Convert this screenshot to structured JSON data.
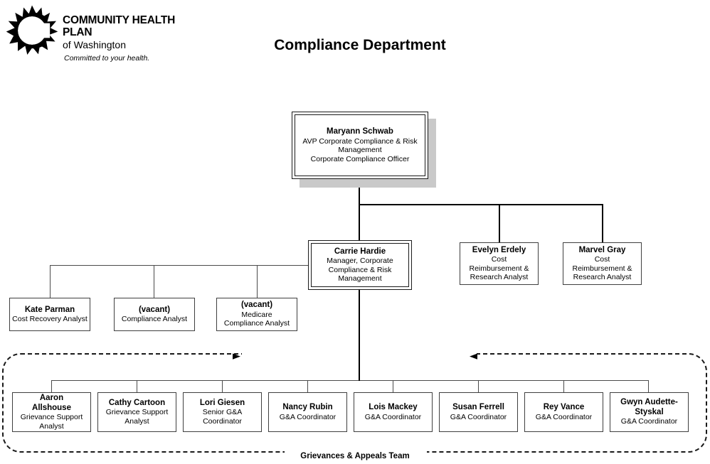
{
  "brand": {
    "logo_icon": "sunburst-c-logo",
    "line1": "COMMUNITY HEALTH PLAN",
    "line2": "of Washington",
    "tagline": "Committed to your health."
  },
  "header": {
    "title": "Compliance Department"
  },
  "org_chart": {
    "type": "org-hierarchy",
    "levels": [
      {
        "level": 1,
        "nodes": [
          {
            "id": "maryann-schwab",
            "name": "Maryann Schwab",
            "title_lines": [
              "AVP Corporate Compliance & Risk",
              "Management",
              "Corporate Compliance Officer"
            ],
            "emphasis": "double-border-shadow"
          }
        ]
      },
      {
        "level": 2,
        "nodes": [
          {
            "id": "carrie-hardie",
            "name": "Carrie Hardie",
            "title_lines": [
              "Manager, Corporate",
              "Compliance & Risk",
              "Management"
            ],
            "emphasis": "double-border",
            "reports_to": "maryann-schwab"
          },
          {
            "id": "evelyn-erdely",
            "name": "Evelyn Erdely",
            "title_lines": [
              "Cost",
              "Reimbursement &",
              "Research Analyst"
            ],
            "emphasis": "single-border",
            "reports_to": "maryann-schwab"
          },
          {
            "id": "marvel-gray",
            "name": "Marvel Gray",
            "title_lines": [
              "Cost",
              "Reimbursement &",
              "Research Analyst"
            ],
            "emphasis": "single-border",
            "reports_to": "maryann-schwab"
          }
        ]
      },
      {
        "level": 3,
        "nodes": [
          {
            "id": "kate-parman",
            "name": "Kate Parman",
            "title_lines": [
              "Cost Recovery Analyst"
            ],
            "emphasis": "single-border",
            "reports_to": "carrie-hardie"
          },
          {
            "id": "vacant-compliance-analyst",
            "name": "(vacant)",
            "title_lines": [
              "Compliance Analyst"
            ],
            "emphasis": "single-border",
            "reports_to": "carrie-hardie"
          },
          {
            "id": "vacant-medicare-compliance-analyst",
            "name": "(vacant)",
            "title_lines": [
              "Medicare",
              "Compliance Analyst"
            ],
            "emphasis": "single-border",
            "reports_to": "carrie-hardie"
          }
        ]
      },
      {
        "level": 4,
        "group_label": "Grievances & Appeals Team",
        "nodes": [
          {
            "id": "aaron-allshouse",
            "name": "Aaron Allshouse",
            "name_lines": [
              "Aaron",
              "Allshouse"
            ],
            "title_lines": [
              "Grievance Support",
              "Analyst"
            ],
            "emphasis": "single-border",
            "reports_to": "carrie-hardie"
          },
          {
            "id": "cathy-cartoon",
            "name": "Cathy Cartoon",
            "name_lines": [
              "Cathy Cartoon"
            ],
            "title_lines": [
              "Grievance Support",
              "Analyst"
            ],
            "emphasis": "single-border",
            "reports_to": "carrie-hardie"
          },
          {
            "id": "lori-giesen",
            "name": "Lori Giesen",
            "name_lines": [
              "Lori Giesen"
            ],
            "title_lines": [
              "Senior G&A",
              "Coordinator"
            ],
            "emphasis": "single-border",
            "reports_to": "carrie-hardie"
          },
          {
            "id": "nancy-rubin",
            "name": "Nancy Rubin",
            "name_lines": [
              "Nancy Rubin"
            ],
            "title_lines": [
              "G&A Coordinator"
            ],
            "emphasis": "single-border",
            "reports_to": "carrie-hardie"
          },
          {
            "id": "lois-mackey",
            "name": "Lois Mackey",
            "name_lines": [
              "Lois Mackey"
            ],
            "title_lines": [
              "G&A Coordinator"
            ],
            "emphasis": "single-border",
            "reports_to": "carrie-hardie"
          },
          {
            "id": "susan-ferrell",
            "name": "Susan Ferrell",
            "name_lines": [
              "Susan Ferrell"
            ],
            "title_lines": [
              "G&A Coordinator"
            ],
            "emphasis": "single-border",
            "reports_to": "carrie-hardie"
          },
          {
            "id": "rey-vance",
            "name": "Rey Vance",
            "name_lines": [
              "Rey Vance"
            ],
            "title_lines": [
              "G&A Coordinator"
            ],
            "emphasis": "single-border",
            "reports_to": "carrie-hardie"
          },
          {
            "id": "gwyn-audette-styskal",
            "name": "Gwyn Audette-Styskal",
            "name_lines": [
              "Gwyn Audette-",
              "Styskal"
            ],
            "title_lines": [
              "G&A Coordinator"
            ],
            "emphasis": "single-border",
            "reports_to": "carrie-hardie"
          }
        ]
      }
    ],
    "annotations": {
      "team_bracket_label": "Grievances & Appeals Team",
      "left_arrow_icon": "arrow-right-icon",
      "right_arrow_icon": "arrow-left-icon"
    },
    "colors": {
      "box_border": "#3f3f3f",
      "emphasis_border": "#1a1a1a",
      "shadow": "#c9c9c9",
      "text": "#000000",
      "background": "#ffffff"
    }
  }
}
